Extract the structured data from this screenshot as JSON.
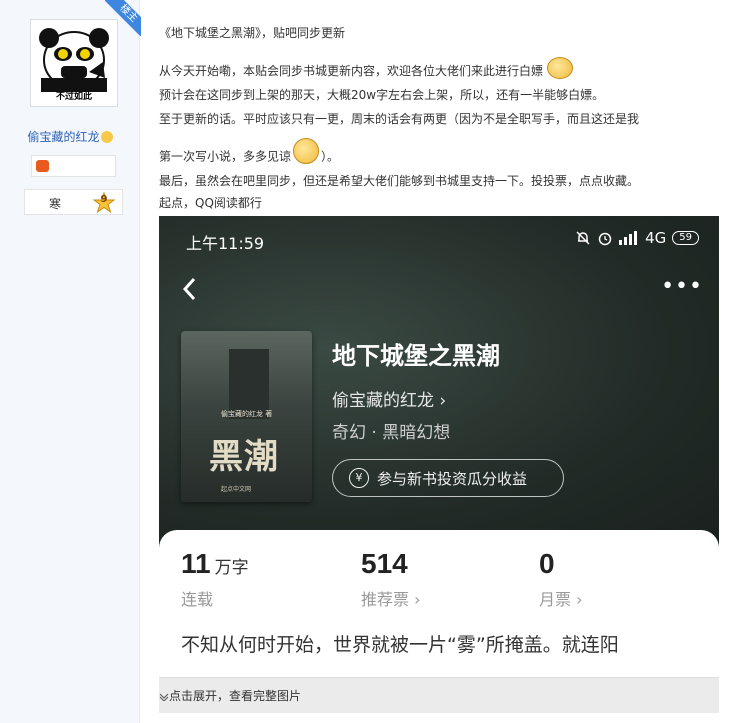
{
  "user": {
    "badge": "楼主",
    "avatar_caption": "不过如此",
    "username": "偷宝藏的红龙",
    "level_name": "寒",
    "level_num": "9"
  },
  "post": {
    "line1": "《地下城堡之黑潮》，贴吧同步更新",
    "line2": "从今天开始嘞，本贴会同步书城更新内容，欢迎各位大佬们来此进行白嫖",
    "line3": "预计会在这同步到上架的那天，大概20w字左右会上架，所以，还有一半能够白嫖。",
    "line4": "至于更新的话。平时应该只有一更，周末的话会有两更（因为不是全职写手，而且这还是我",
    "line5a": "第一次写小说，多多见谅",
    "line5b": "）。",
    "line6": "最后，虽然会在吧里同步，但还是希望大佬们能够到书城里支持一下。投投票，点点收藏。",
    "line7": "起点，QQ阅读都行"
  },
  "phone": {
    "time": "上午11:59",
    "network": "4G",
    "battery": "59",
    "more": "•••",
    "book_title": "地下城堡之黑潮",
    "author": "偷宝藏的红龙 ›",
    "genre": "奇幻 · 黑暗幻想",
    "invest_label": "参与新书投资瓜分收益",
    "yen": "¥",
    "cover_small": "偷宝藏的红龙 著",
    "cover_title": "黑潮",
    "cover_pub": "起点中文网",
    "stats": [
      {
        "num": "11",
        "unit": "万字",
        "label": "连载"
      },
      {
        "num": "514",
        "unit": "",
        "label": "推荐票 ›"
      },
      {
        "num": "0",
        "unit": "",
        "label": "月票 ›"
      }
    ],
    "intro": "不知从何时开始，世界就被一片“雾”所掩盖。就连阳"
  },
  "expand": {
    "label": "点击展开，查看完整图片"
  }
}
